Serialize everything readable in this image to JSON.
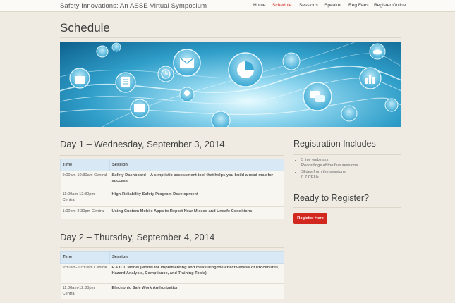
{
  "site": {
    "title": "Safety Innovations: An ASSE Virtual Symposium"
  },
  "nav": {
    "items": [
      {
        "label": "Home",
        "active": false
      },
      {
        "label": "Schedule",
        "active": true
      },
      {
        "label": "Sessions",
        "active": false
      },
      {
        "label": "Speaker",
        "active": false
      },
      {
        "label": "Reg Fees",
        "active": false
      },
      {
        "label": "Register Online",
        "active": false
      }
    ]
  },
  "page": {
    "title": "Schedule"
  },
  "banner": {
    "icons": [
      "envelope-icon",
      "pie-chart-icon",
      "clock-icon",
      "document-icon",
      "chat-icon",
      "cloud-icon",
      "bar-chart-icon",
      "lightbulb-icon",
      "tv-icon",
      "shopping-bag-icon",
      "camera-icon",
      "music-icon",
      "people-icon",
      "gear-icon",
      "chart-icon",
      "mail-icon"
    ]
  },
  "days": [
    {
      "heading": "Day 1 – Wednesday, September 3, 2014",
      "columns": [
        "Time",
        "Session"
      ],
      "rows": [
        {
          "time": "9:00am-10:30am Central",
          "session": "Safety Dashboard – A simplistic assessment tool that helps you build a road map for success"
        },
        {
          "time": "11:00am-12:30pm Central",
          "session": "High-Reliability Safety Program Development"
        },
        {
          "time": "1:00pm-2:30pm Central",
          "session": "Using Custom Mobile Apps to Report Near Misses and Unsafe Conditions"
        }
      ]
    },
    {
      "heading": "Day 2 – Thursday, September 4, 2014",
      "columns": [
        "Time",
        "Session"
      ],
      "rows": [
        {
          "time": "9:30am-10:30am Central",
          "session": "P.A.C.T. Model (Model for implementing and measuring the effectiveness of Procedures, Hazard Analysis, Compliance, and Training Tools)"
        },
        {
          "time": "11:00am-12:30pm Central",
          "session": "Electronic Safe Work Authorization"
        }
      ]
    }
  ],
  "sidebar": {
    "registration_heading": "Registration Includes",
    "includes": [
      "5 live webinars",
      "Recordings of the five sessions",
      "Slides from the sessions",
      "0.7 CEUs"
    ],
    "ready_heading": "Ready to Register?",
    "register_button": "Register Here"
  },
  "colors": {
    "accent": "#d1271f",
    "table_header": "#d8e9f5",
    "background": "#efebe3"
  }
}
